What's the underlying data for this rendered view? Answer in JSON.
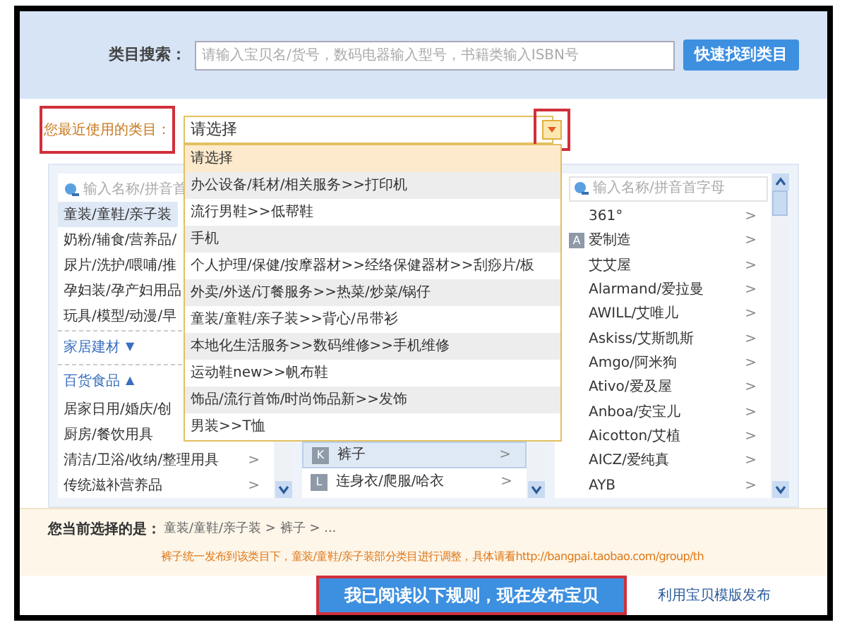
{
  "search": {
    "label": "类目搜索：",
    "placeholder": "请输入宝贝名/货号，数码电器输入型号，书籍类输入ISBN号",
    "button": "快速找到类目"
  },
  "recent": {
    "label": "您最近使用的类目：",
    "value": "请选择",
    "options": [
      {
        "text": "请选择",
        "selected": true
      },
      {
        "text": "办公设备/耗材/相关服务>>打印机",
        "selected": false
      },
      {
        "text": "流行男鞋>>低帮鞋",
        "selected": false
      },
      {
        "text": "手机",
        "selected": false
      },
      {
        "text": "个人护理/保健/按摩器材>>经络保健器材>>刮痧片/板",
        "selected": false
      },
      {
        "text": "外卖/外送/订餐服务>>热菜/炒菜/锅仔",
        "selected": false
      },
      {
        "text": "童装/童鞋/亲子装>>背心/吊带衫",
        "selected": false
      },
      {
        "text": "本地化生活服务>>数码维修>>手机维修",
        "selected": false
      },
      {
        "text": "运动鞋new>>帆布鞋",
        "selected": false
      },
      {
        "text": "饰品/流行首饰/时尚饰品新>>发饰",
        "selected": false
      },
      {
        "text": "男装>>T恤",
        "selected": false
      }
    ]
  },
  "categories": {
    "left": {
      "placeholder": "输入名称/拼音首",
      "items": [
        {
          "kind": "item",
          "text": "童装/童鞋/亲子装",
          "selected": true
        },
        {
          "kind": "item",
          "text": "奶粉/辅食/营养品/",
          "selected": false
        },
        {
          "kind": "item",
          "text": "尿片/洗护/喂哺/推",
          "selected": false
        },
        {
          "kind": "item",
          "text": "孕妇装/孕产妇用品",
          "selected": false
        },
        {
          "kind": "item",
          "text": "玩具/模型/动漫/早",
          "selected": false
        },
        {
          "kind": "group",
          "text": "家居建材",
          "toggle": "▼"
        },
        {
          "kind": "group",
          "text": "百货食品",
          "toggle": "▲"
        },
        {
          "kind": "item",
          "text": "居家日用/婚庆/创",
          "selected": false
        },
        {
          "kind": "item",
          "text": "厨房/餐饮用具",
          "selected": false
        },
        {
          "kind": "item",
          "text": "清洁/卫浴/收纳/整理用具",
          "selected": false,
          "arrow": ">"
        },
        {
          "kind": "item",
          "text": "传统滋补营养品",
          "selected": false,
          "arrow": ">"
        }
      ]
    },
    "middle": {
      "items": [
        {
          "letter": "K",
          "text": "裤子",
          "arrow": ">",
          "selected": true
        },
        {
          "letter": "L",
          "text": "连身衣/爬服/哈衣",
          "arrow": ">",
          "selected": false
        }
      ]
    },
    "right": {
      "placeholder": "输入名称/拼音首字母",
      "items": [
        {
          "text": "361°",
          "arrow": ">"
        },
        {
          "letter": "A",
          "text": "爱制造",
          "arrow": ">"
        },
        {
          "text": "艾艾屋",
          "arrow": ">"
        },
        {
          "text": "Alarmand/爱拉曼",
          "arrow": ">"
        },
        {
          "text": "AWILL/艾唯儿",
          "arrow": ">"
        },
        {
          "text": "Askiss/艾斯凯斯",
          "arrow": ">"
        },
        {
          "text": "Amgo/阿米狗",
          "arrow": ">"
        },
        {
          "text": "Ativo/爱及屋",
          "arrow": ">"
        },
        {
          "text": "Anboa/安宝儿",
          "arrow": ">"
        },
        {
          "text": "Aicotton/艾植",
          "arrow": ">"
        },
        {
          "text": "AICZ/爱纯真",
          "arrow": ">"
        },
        {
          "text": "AYB",
          "arrow": ">"
        }
      ]
    }
  },
  "selection": {
    "label": "您当前选择的是：",
    "path": "童装/童鞋/亲子装 > 裤子 > ...",
    "notice": "裤子统一发布到该类目下，童装/童鞋/亲子装部分类目进行调整，具体请看http://bangpai.taobao.com/group/th"
  },
  "actions": {
    "primary": "我已阅读以下规则，现在发布宝贝",
    "link": "利用宝贝模版发布"
  }
}
